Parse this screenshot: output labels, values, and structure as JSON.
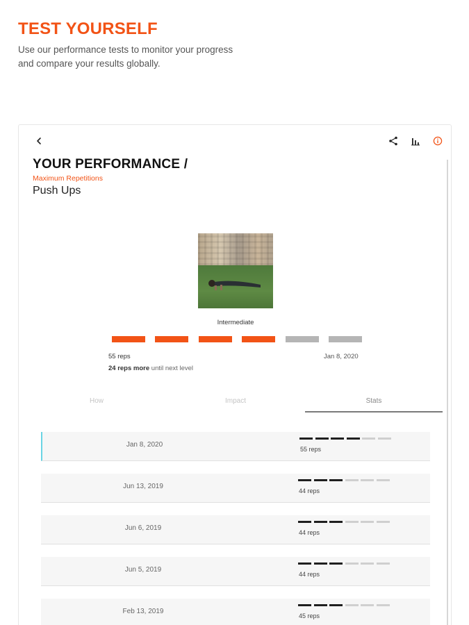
{
  "promo": {
    "title": "TEST YOURSELF",
    "subtitle": "Use our performance tests to monitor your progress and compare your results globally."
  },
  "icons": {
    "back": "chevron-left-icon",
    "share": "share-icon",
    "chart": "bar-chart-icon",
    "info": "info-icon"
  },
  "colors": {
    "accent": "#f25316",
    "bar_active": "#f25316",
    "bar_inactive": "#b5b5b5",
    "mini_active": "#1f1f1f",
    "mini_inactive": "#cfcfcf",
    "active_row_marker": "#6ad4e4"
  },
  "performance": {
    "title": "YOUR PERFORMANCE /",
    "category": "Maximum Repetitions",
    "exercise": "Push Ups"
  },
  "level": {
    "label": "Intermediate",
    "filled_segments": 4,
    "total_segments": 6,
    "current_reps": "55 reps",
    "date": "Jan 8, 2020",
    "next_reps": "24 reps",
    "next_more": "more",
    "next_suffix": "until next level"
  },
  "tabs": [
    {
      "label": "How",
      "selected": false
    },
    {
      "label": "Impact",
      "selected": false
    },
    {
      "label": "Stats",
      "selected": true
    }
  ],
  "stats": [
    {
      "date": "Jan 8, 2020",
      "reps": "55 reps",
      "filled": 4,
      "total": 6,
      "active": true
    },
    {
      "date": "Jun 13, 2019",
      "reps": "44 reps",
      "filled": 3,
      "total": 6,
      "active": false
    },
    {
      "date": "Jun 6, 2019",
      "reps": "44 reps",
      "filled": 3,
      "total": 6,
      "active": false
    },
    {
      "date": "Jun 5, 2019",
      "reps": "44 reps",
      "filled": 3,
      "total": 6,
      "active": false
    },
    {
      "date": "Feb 13, 2019",
      "reps": "45 reps",
      "filled": 3,
      "total": 6,
      "active": false
    }
  ]
}
